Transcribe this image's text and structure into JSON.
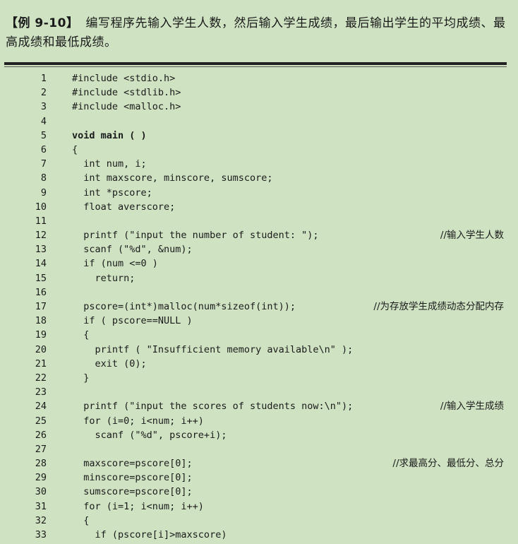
{
  "intro": {
    "label": "【例 9-10】",
    "text": "编写程序先输入学生人数，然后输入学生成绩，最后输出学生的平均成绩、最高成绩和最低成绩。"
  },
  "code": [
    {
      "n": "1",
      "code": "#include <stdio.h>",
      "comment": ""
    },
    {
      "n": "2",
      "code": "#include <stdlib.h>",
      "comment": ""
    },
    {
      "n": "3",
      "code": "#include <malloc.h>",
      "comment": ""
    },
    {
      "n": "4",
      "code": "",
      "comment": ""
    },
    {
      "n": "5",
      "code": "void main ( )",
      "comment": "",
      "bold": true
    },
    {
      "n": "6",
      "code": "{",
      "comment": ""
    },
    {
      "n": "7",
      "code": "  int num, i;",
      "comment": ""
    },
    {
      "n": "8",
      "code": "  int maxscore, minscore, sumscore;",
      "comment": ""
    },
    {
      "n": "9",
      "code": "  int *pscore;",
      "comment": ""
    },
    {
      "n": "10",
      "code": "  float averscore;",
      "comment": ""
    },
    {
      "n": "11",
      "code": "",
      "comment": ""
    },
    {
      "n": "12",
      "code": "  printf (\"input the number of student: \");",
      "comment": "//输入学生人数"
    },
    {
      "n": "13",
      "code": "  scanf (\"%d\", &num);",
      "comment": ""
    },
    {
      "n": "14",
      "code": "  if (num <=0 )",
      "comment": ""
    },
    {
      "n": "15",
      "code": "    return;",
      "comment": ""
    },
    {
      "n": "16",
      "code": "",
      "comment": ""
    },
    {
      "n": "17",
      "code": "  pscore=(int*)malloc(num*sizeof(int));",
      "comment": "//为存放学生成绩动态分配内存"
    },
    {
      "n": "18",
      "code": "  if ( pscore==NULL )",
      "comment": ""
    },
    {
      "n": "19",
      "code": "  {",
      "comment": ""
    },
    {
      "n": "20",
      "code": "    printf ( \"Insufficient memory available\\n\" );",
      "comment": ""
    },
    {
      "n": "21",
      "code": "    exit (0);",
      "comment": ""
    },
    {
      "n": "22",
      "code": "  }",
      "comment": ""
    },
    {
      "n": "23",
      "code": "",
      "comment": ""
    },
    {
      "n": "24",
      "code": "  printf (\"input the scores of students now:\\n\");",
      "comment": "//输入学生成绩"
    },
    {
      "n": "25",
      "code": "  for (i=0; i<num; i++)",
      "comment": ""
    },
    {
      "n": "26",
      "code": "    scanf (\"%d\", pscore+i);",
      "comment": ""
    },
    {
      "n": "27",
      "code": "",
      "comment": ""
    },
    {
      "n": "28",
      "code": "  maxscore=pscore[0];",
      "comment": "//求最高分、最低分、总分"
    },
    {
      "n": "29",
      "code": "  minscore=pscore[0];",
      "comment": ""
    },
    {
      "n": "30",
      "code": "  sumscore=pscore[0];",
      "comment": ""
    },
    {
      "n": "31",
      "code": "  for (i=1; i<num; i++)",
      "comment": ""
    },
    {
      "n": "32",
      "code": "  {",
      "comment": ""
    },
    {
      "n": "33",
      "code": "    if (pscore[i]>maxscore)",
      "comment": ""
    }
  ]
}
